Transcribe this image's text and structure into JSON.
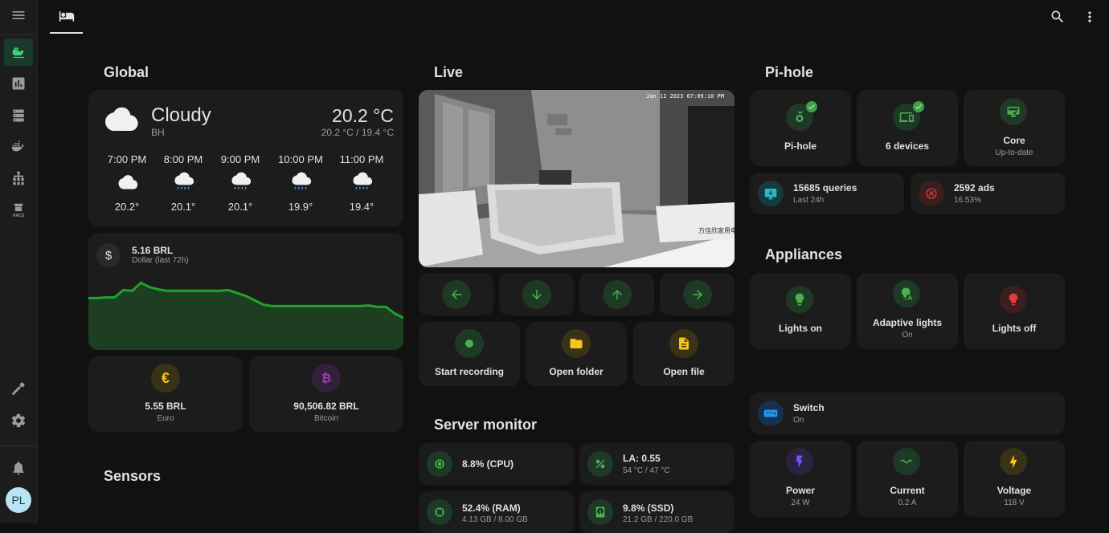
{
  "sidebar": {
    "items": [
      {
        "name": "menu-icon"
      },
      {
        "name": "duck-icon",
        "active": true
      },
      {
        "name": "chart-icon"
      },
      {
        "name": "server-icon"
      },
      {
        "name": "docker-icon"
      },
      {
        "name": "network-icon"
      },
      {
        "name": "hacs-icon"
      },
      {
        "name": "hammer-icon"
      },
      {
        "name": "settings-icon"
      },
      {
        "name": "bell-icon"
      }
    ],
    "hacs_label": "HACS",
    "avatar": "PL"
  },
  "topbar": {
    "tab_icon": "bed-icon",
    "search_icon": "search-icon",
    "more_icon": "more-vert-icon"
  },
  "sections": {
    "global": "Global",
    "live": "Live",
    "pihole": "Pi-hole",
    "appliances": "Appliances",
    "server_monitor": "Server monitor",
    "sensors": "Sensors"
  },
  "weather": {
    "condition": "Cloudy",
    "location": "BH",
    "temp": "20.2 °C",
    "range": "20.2 °C / 19.4 °C",
    "forecast": [
      {
        "time": "7:00 PM",
        "temp": "20.2°",
        "icon": "cloud-icon"
      },
      {
        "time": "8:00 PM",
        "temp": "20.1°",
        "icon": "rain-icon"
      },
      {
        "time": "9:00 PM",
        "temp": "20.1°",
        "icon": "rain-icon"
      },
      {
        "time": "10:00 PM",
        "temp": "19.9°",
        "icon": "rain-icon"
      },
      {
        "time": "11:00 PM",
        "temp": "19.4°",
        "icon": "rain-icon"
      }
    ]
  },
  "dollar": {
    "value": "5.16 BRL",
    "label": "Dollar (last 72h)",
    "icon": "dollar-icon",
    "color": "#1fa32a"
  },
  "euro": {
    "value": "5.55 BRL",
    "label": "Euro",
    "icon": "euro-icon",
    "color": "#e8b91a"
  },
  "bitcoin": {
    "value": "90,506.82 BRL",
    "label": "Bitcoin",
    "icon": "bitcoin-icon",
    "color": "#9c3fb8"
  },
  "camera": {
    "timestamp": "Jan 11 2023 07:09:10 PM",
    "box_text": "万佳欣家用电"
  },
  "ptz": [
    {
      "name": "arrow-left-icon"
    },
    {
      "name": "arrow-down-icon"
    },
    {
      "name": "arrow-up-icon"
    },
    {
      "name": "arrow-right-icon"
    }
  ],
  "camera_actions": [
    {
      "label": "Start recording",
      "icon": "record-icon",
      "color": "#4caf50"
    },
    {
      "label": "Open folder",
      "icon": "folder-icon",
      "color": "#f5c518"
    },
    {
      "label": "Open file",
      "icon": "file-icon",
      "color": "#f5c518"
    }
  ],
  "server": [
    {
      "label": "8.8% (CPU)",
      "sub": "",
      "icon": "cpu-icon"
    },
    {
      "label": "LA: 0.55",
      "sub": "54 °C / 47 °C",
      "icon": "percent-icon"
    },
    {
      "label": "52.4% (RAM)",
      "sub": "4.13 GB / 8.00 GB",
      "icon": "memory-icon"
    },
    {
      "label": "9.8% (SSD)",
      "sub": "21.2 GB / 220.0 GB",
      "icon": "harddisk-icon"
    }
  ],
  "pihole": {
    "tiles": [
      {
        "label": "Pi-hole",
        "sub": "",
        "icon": "pihole-icon",
        "badge": true,
        "color": "#4caf50"
      },
      {
        "label": "6 devices",
        "sub": "",
        "icon": "devices-icon",
        "badge": true,
        "color": "#4caf50"
      },
      {
        "label": "Core",
        "sub": "Up-to-date",
        "icon": "update-icon",
        "badge": false,
        "color": "#4caf50"
      }
    ],
    "queries": {
      "label": "15685 queries",
      "sub": "Last 24h",
      "icon": "monitor-icon",
      "color": "#29b6c6"
    },
    "ads": {
      "label": "2592 ads",
      "sub": "16.53%",
      "icon": "block-icon",
      "color": "#e53935"
    }
  },
  "appliances": [
    {
      "label": "Lights on",
      "sub": "",
      "icon": "bulb-on-icon",
      "color": "#4caf50"
    },
    {
      "label": "Adaptive lights",
      "sub": "On",
      "icon": "bulb-auto-icon",
      "color": "#4caf50"
    },
    {
      "label": "Lights off",
      "sub": "",
      "icon": "bulb-off-icon",
      "color": "#e53935"
    }
  ],
  "switch": {
    "label": "Switch",
    "sub": "On",
    "icon": "switch-icon",
    "color": "#2196f3"
  },
  "energy": [
    {
      "label": "Power",
      "sub": "24 W",
      "icon": "flash-icon",
      "color": "#7c4dff"
    },
    {
      "label": "Current",
      "sub": "0.2 A",
      "icon": "current-icon",
      "color": "#4caf50"
    },
    {
      "label": "Voltage",
      "sub": "118 V",
      "icon": "voltage-icon",
      "color": "#f5c518"
    }
  ],
  "chart_data": {
    "type": "area",
    "series": [
      {
        "values": [
          3.55,
          3.55,
          3.6,
          3.6,
          4.1,
          4.05,
          4.6,
          4.3,
          4.15,
          4.05,
          4.05,
          4.05,
          4.05,
          4.05,
          4.05,
          4.05,
          4.1,
          3.9,
          3.7,
          3.4,
          3.1,
          3.0,
          3.0,
          3.0,
          3.0,
          3.0,
          3.0,
          3.0,
          3.0,
          3.0,
          3.0,
          3.0,
          3.05,
          2.95,
          2.95,
          2.5,
          2.2
        ]
      }
    ],
    "color": "#1fa32a"
  }
}
